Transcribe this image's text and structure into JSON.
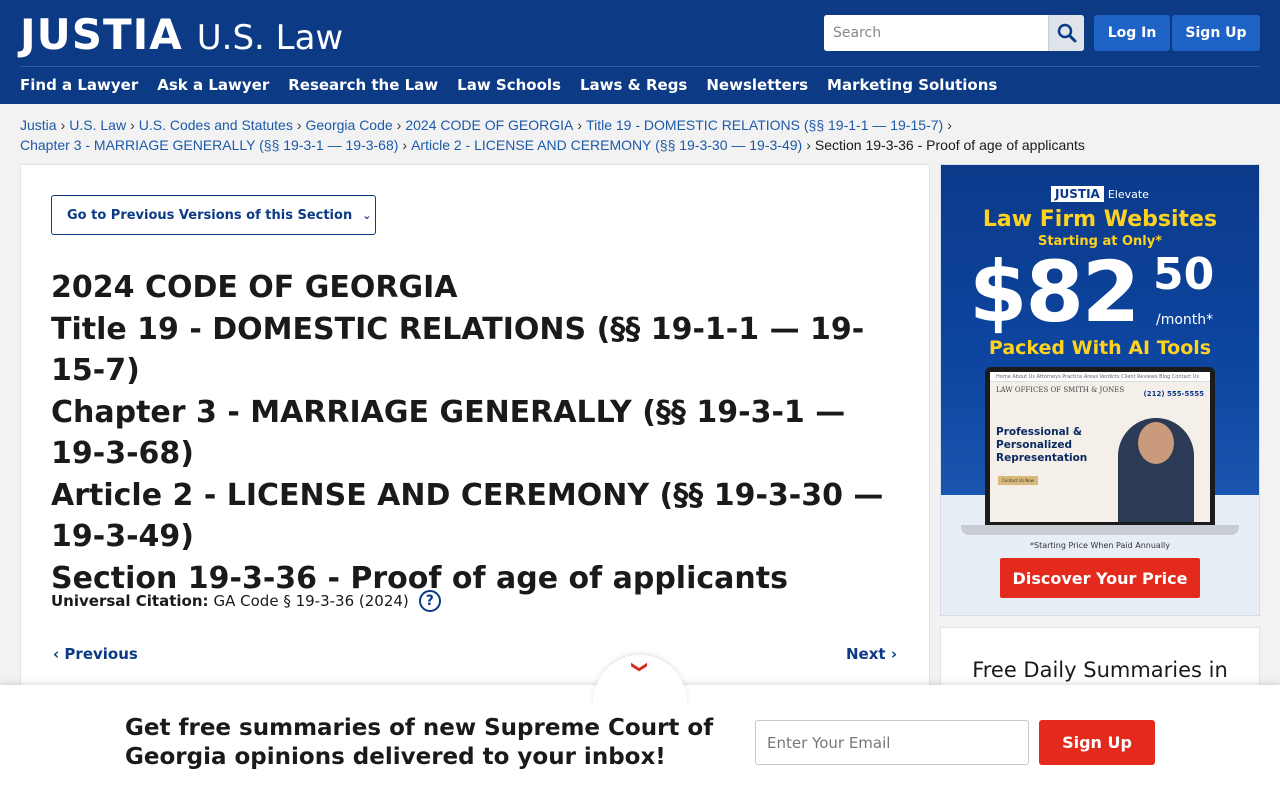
{
  "header": {
    "logo_main": "JUSTIA",
    "logo_sub": "U.S. Law",
    "search_placeholder": "Search",
    "login_label": "Log In",
    "signup_label": "Sign Up",
    "nav": [
      "Find a Lawyer",
      "Ask a Lawyer",
      "Research the Law",
      "Law Schools",
      "Laws & Regs",
      "Newsletters",
      "Marketing Solutions"
    ]
  },
  "breadcrumb": {
    "items": [
      "Justia",
      "U.S. Law",
      "U.S. Codes and Statutes",
      "Georgia Code",
      "2024 CODE OF GEORGIA",
      "Title 19 - DOMESTIC RELATIONS (§§ 19-1-1 — 19-15-7)",
      "Chapter 3 - MARRIAGE GENERALLY (§§ 19-3-1 — 19-3-68)",
      "Article 2 - LICENSE AND CEREMONY (§§ 19-3-30 — 19-3-49)"
    ],
    "separator": "›",
    "current": "Section 19-3-36 - Proof of age of applicants"
  },
  "main": {
    "prev_versions_label": "Go to Previous Versions of this Section",
    "titles": [
      "2024 CODE OF GEORGIA",
      "Title 19 - DOMESTIC RELATIONS (§§ 19-1-1 — 19-15-7)",
      "Chapter 3 - MARRIAGE GENERALLY (§§ 19-3-1 — 19-3-68)",
      "Article 2 - LICENSE AND CEREMONY (§§ 19-3-30 — 19-3-49)",
      "Section 19-3-36 - Proof of age of applicants"
    ],
    "citation_label": "Universal Citation:",
    "citation_value": "GA Code § 19-3-36 (2024)",
    "help_glyph": "?",
    "previous_label": "Previous",
    "next_label": "Next"
  },
  "ad": {
    "brand": "JUSTIA",
    "brand_sub": "Elevate",
    "headline": "Law Firm Websites",
    "subhead": "Starting at Only*",
    "price": "$82",
    "cents": "50",
    "per": "/month*",
    "packed": "Packed With AI Tools",
    "screen_nav": "Home   About Us   Attorneys   Practice Areas   Verdicts   Client Reviews   Blog   Contact Us",
    "screen_firm": "LAW OFFICES OF SMITH & JONES",
    "screen_phone": "(212) 555-5555",
    "screen_text": "Professional & Personalized Representation",
    "screen_btn": "Contact Us Now",
    "note": "*Starting Price When Paid Annually",
    "cta": "Discover Your Price"
  },
  "daily": {
    "title": "Free Daily Summaries in"
  },
  "banner": {
    "text": "Get free summaries of new Supreme Court of Georgia opinions delivered to your inbox!",
    "email_placeholder": "Enter Your Email",
    "signup_label": "Sign Up"
  },
  "colors": {
    "brand_blue": "#0d3a85",
    "button_blue": "#1f63c6",
    "link_blue": "#1e5aa8",
    "cta_red": "#e32a1d",
    "ad_yellow": "#ffd21f"
  }
}
